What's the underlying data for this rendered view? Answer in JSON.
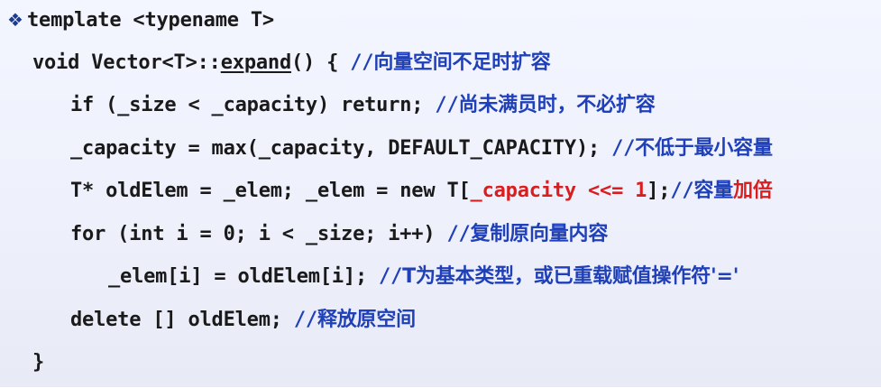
{
  "lines": [
    {
      "bullet": "❖",
      "code": "template <typename T>"
    },
    {
      "code_a": "void Vector<T>::",
      "code_fn": "expand",
      "code_b": "() { ",
      "slashes": "//",
      "comment": "向量空间不足时扩容"
    },
    {
      "code": "if (_size < _capacity) return; ",
      "slashes": "//",
      "comment": "尚未满员时，不必扩容"
    },
    {
      "code": "_capacity = max(_capacity, DEFAULT_CAPACITY); ",
      "slashes": "//",
      "comment": "不低于最小容量"
    },
    {
      "code_a": "T* oldElem = _elem; _elem = new T[",
      "code_red": "_capacity <<= 1",
      "code_b": "];",
      "slashes": "//",
      "comment_a": "容量",
      "comment_red": "加倍"
    },
    {
      "code": "for (int i = 0; i < _size; i++) ",
      "slashes": "//",
      "comment": "复制原向量内容"
    },
    {
      "code": "_elem[i] = oldElem[i]; ",
      "slashes": "//",
      "comment": "T为基本类型，或已重载赋值操作符'='"
    },
    {
      "code": "delete [] oldElem; ",
      "slashes": "//",
      "comment": "释放原空间"
    },
    {
      "code": "}"
    }
  ],
  "colors": {
    "code": "#1a1a1a",
    "comment": "#1f40b8",
    "highlight": "#d81e1e",
    "background": "#eef0fb"
  }
}
